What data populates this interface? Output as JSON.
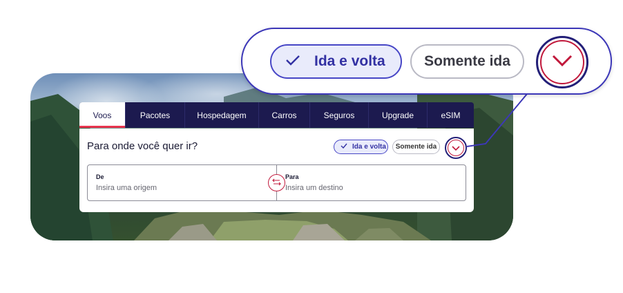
{
  "tabs": [
    {
      "label": "Voos",
      "active": true
    },
    {
      "label": "Pacotes"
    },
    {
      "label": "Hospedagem"
    },
    {
      "label": "Carros"
    },
    {
      "label": "Seguros"
    },
    {
      "label": "Upgrade"
    },
    {
      "label": "eSIM"
    }
  ],
  "search": {
    "title": "Para onde você quer ir?",
    "trip_type": {
      "round_trip_label": "Ida e volta",
      "one_way_label": "Somente ida",
      "selected": "Ida e volta"
    },
    "from": {
      "label": "De",
      "placeholder": "Insira uma origem"
    },
    "to": {
      "label": "Para",
      "placeholder": "Insira um destino"
    }
  },
  "callout": {
    "round_trip_label": "Ida e volta",
    "one_way_label": "Somente ida"
  },
  "icons": {
    "check": "check-icon",
    "toggle": "chevron-down-icon",
    "swap": "swap-arrows-icon"
  },
  "colors": {
    "brand_navy": "#1c1a4f",
    "accent_red": "#e8344e",
    "selected_pill_bg": "#e9ebfb",
    "selected_pill_border": "#4746c6",
    "callout_border": "#3c37b8"
  }
}
